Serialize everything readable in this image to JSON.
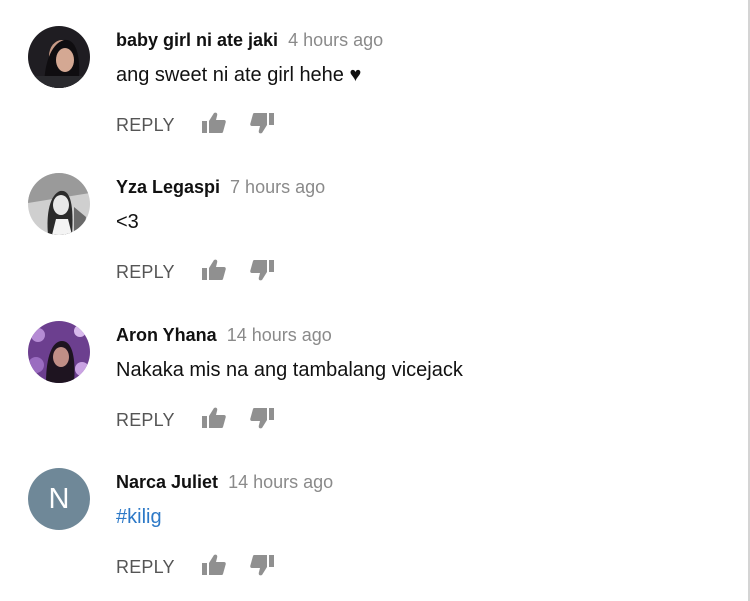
{
  "actions": {
    "reply_label": "REPLY",
    "like_icon": "thumbs-up-icon",
    "dislike_icon": "thumbs-down-icon"
  },
  "comments": [
    {
      "author": "baby girl ni ate jaki",
      "time": "4 hours ago",
      "text": "ang sweet ni ate girl hehe ♥",
      "avatar": {
        "type": "photo"
      }
    },
    {
      "author": "Yza Legaspi",
      "time": "7 hours ago",
      "text": "<3",
      "avatar": {
        "type": "photo"
      }
    },
    {
      "author": "Aron Yhana",
      "time": "14 hours ago",
      "text": "Nakaka mis na ang tambalang vicejack",
      "avatar": {
        "type": "photo"
      }
    },
    {
      "author": "Narca Juliet",
      "time": "14 hours ago",
      "text": "#kilig",
      "avatar": {
        "type": "letter",
        "letter": "N",
        "color": "#6f8898"
      }
    }
  ],
  "colors": {
    "author": "#111111",
    "timestamp": "#8a8a8a",
    "hashtag": "#2d79c7",
    "action": "#555555"
  }
}
